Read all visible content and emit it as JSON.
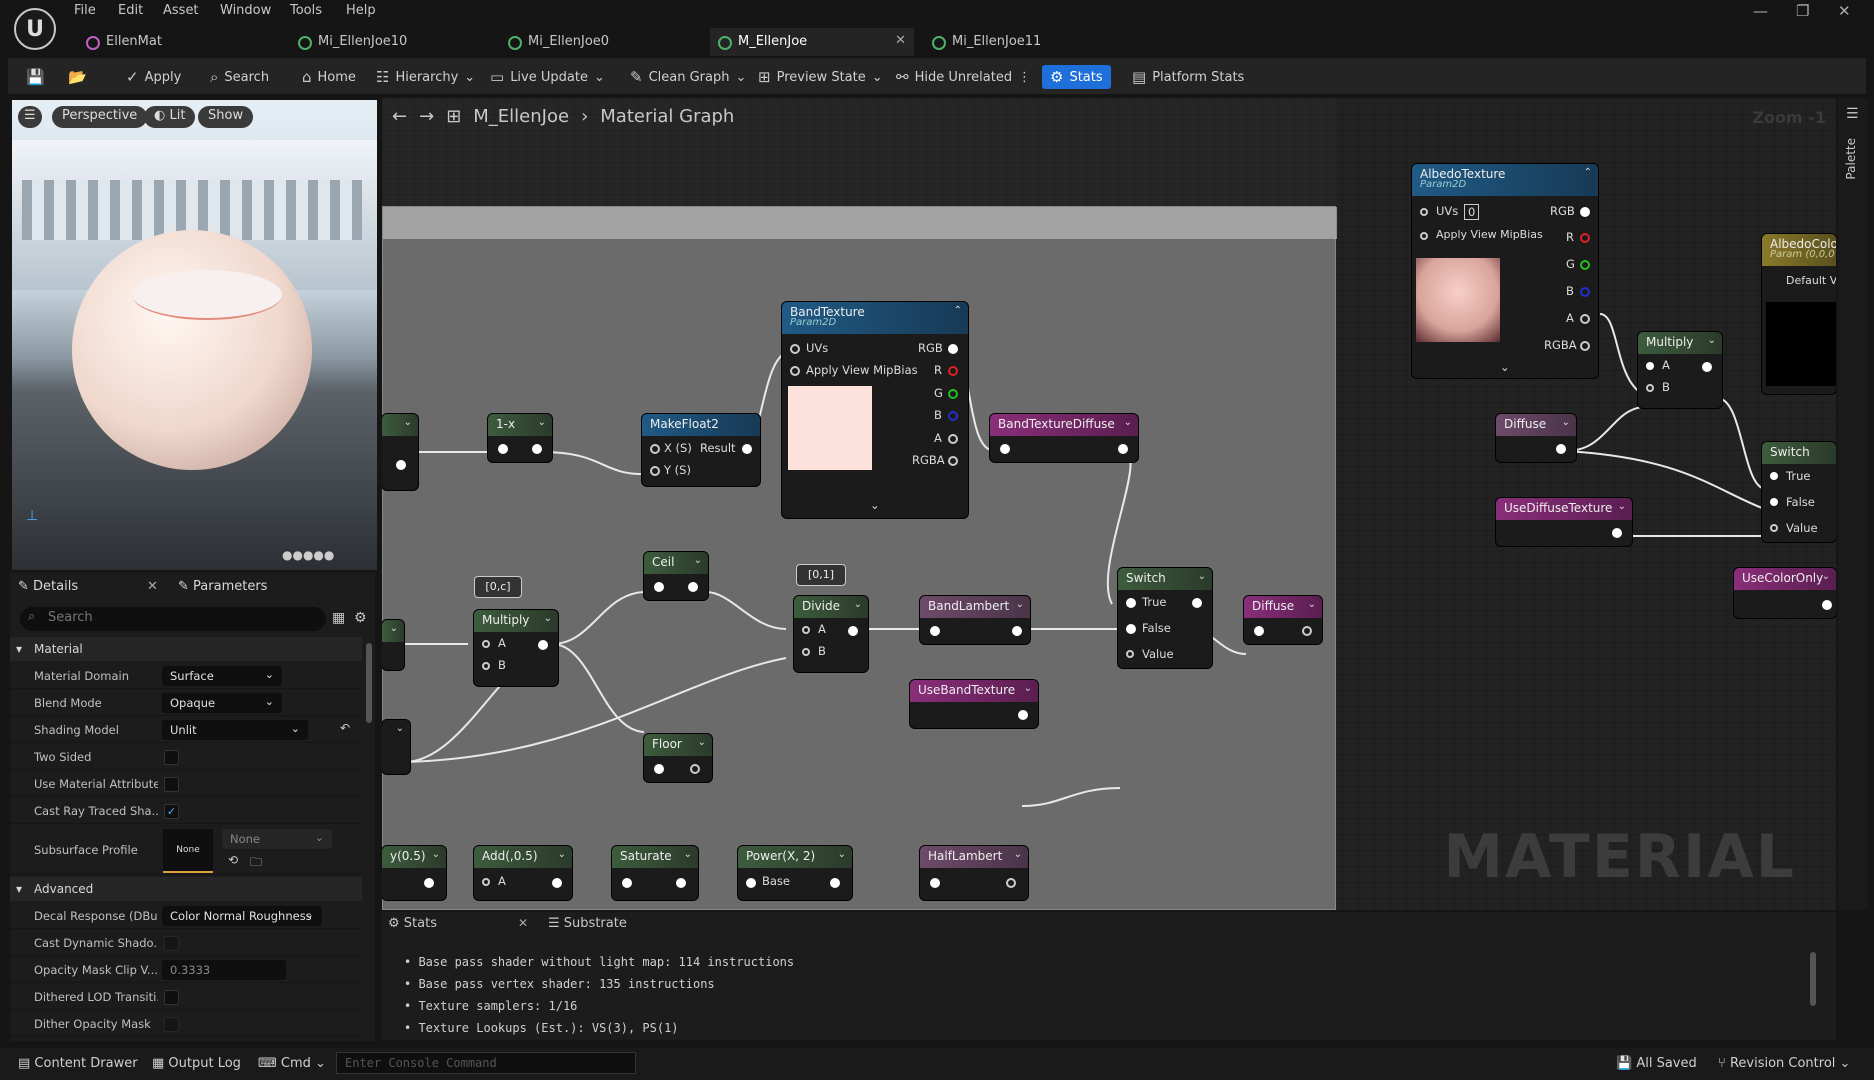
{
  "menu": [
    "File",
    "Edit",
    "Asset",
    "Window",
    "Tools",
    "Help"
  ],
  "tabs": [
    {
      "label": "EllenMat",
      "type": "mat"
    },
    {
      "label": "Mi_EllenJoe10",
      "type": "inst"
    },
    {
      "label": "Mi_EllenJoe0",
      "type": "inst"
    },
    {
      "label": "M_EllenJoe",
      "type": "inst",
      "active": true
    },
    {
      "label": "Mi_EllenJoe11",
      "type": "inst"
    }
  ],
  "toolbar": {
    "apply": "Apply",
    "search": "Search",
    "home": "Home",
    "hierarchy": "Hierarchy",
    "live_update": "Live Update",
    "clean_graph": "Clean Graph",
    "preview_state": "Preview State",
    "hide_unrelated": "Hide Unrelated",
    "stats": "Stats",
    "platform_stats": "Platform Stats"
  },
  "viewport": {
    "perspective": "Perspective",
    "lit": "Lit",
    "show": "Show"
  },
  "details": {
    "tab_details": "Details",
    "tab_parameters": "Parameters",
    "search_placeholder": "Search",
    "section_material": "Material",
    "section_advanced": "Advanced",
    "material_domain_lbl": "Material Domain",
    "material_domain": "Surface",
    "blend_mode_lbl": "Blend Mode",
    "blend_mode": "Opaque",
    "shading_model_lbl": "Shading Model",
    "shading_model": "Unlit",
    "two_sided_lbl": "Two Sided",
    "use_mat_attr_lbl": "Use Material Attributes",
    "cast_ray_lbl": "Cast Ray Traced Sha...",
    "subsurface_lbl": "Subsurface Profile",
    "subsurface_thumb": "None",
    "subsurface_val": "None",
    "decal_lbl": "Decal Response (DBu...",
    "decal_val": "Color Normal Roughness",
    "cast_dyn_lbl": "Cast Dynamic Shado...",
    "opacity_clip_lbl": "Opacity Mask Clip V...",
    "opacity_clip_val": "0.3333",
    "dithered_lod_lbl": "Dithered LOD Transiti...",
    "dither_opacity_lbl": "Dither Opacity Mask"
  },
  "graph": {
    "breadcrumb_root": "M_EllenJoe",
    "breadcrumb_leaf": "Material Graph",
    "zoom": "Zoom -1",
    "watermark": "MATERIAL",
    "palette": "Palette",
    "nodes": {
      "one_minus": "1-x",
      "make_float2": "MakeFloat2",
      "mf2_x": "X (S)",
      "mf2_result": "Result",
      "mf2_y": "Y (S)",
      "band_texture": "BandTexture",
      "param2d": "Param2D",
      "uvs": "UVs",
      "apply_mip": "Apply View MipBias",
      "rgb": "RGB",
      "r": "R",
      "g": "G",
      "b": "B",
      "a": "A",
      "rgba": "RGBA",
      "band_tex_diffuse": "BandTextureDiffuse",
      "ceil": "Ceil",
      "multiply": "Multiply",
      "pin_a": "A",
      "pin_b": "B",
      "clamp_badge": "[0,c]",
      "divide_badge": "[0,1]",
      "divide": "Divide",
      "band_lambert": "BandLambert",
      "switch": "Switch",
      "sw_true": "True",
      "sw_false": "False",
      "sw_value": "Value",
      "diffuse_out": "Diffuse",
      "use_band_texture": "UseBandTexture",
      "floor": "Floor",
      "y05": "y(0.5)",
      "add05": "Add(,0.5)",
      "saturate": "Saturate",
      "power": "Power(X, 2)",
      "power_base": "Base",
      "half_lambert": "HalfLambert",
      "albedo_texture": "AlbedoTexture",
      "uvs_idx": "0",
      "albedo_color": "AlbedoColo",
      "albedo_color_sub": "Param (0,0,0",
      "default_val": "Default V",
      "multiply2": "Multiply",
      "diffuse_param": "Diffuse",
      "use_diffuse_tex": "UseDiffuseTexture",
      "switch2": "Switch",
      "use_color_only": "UseColorOnly"
    }
  },
  "stats_panel": {
    "tab_stats": "Stats",
    "tab_substrate": "Substrate",
    "lines": [
      "• Base pass shader without light map: 114 instructions",
      "• Base pass vertex shader: 135 instructions",
      "• Texture samplers: 1/16",
      "• Texture Lookups (Est.): VS(3), PS(1)"
    ]
  },
  "statusbar": {
    "content_drawer": "Content Drawer",
    "output_log": "Output Log",
    "cmd": "Cmd",
    "console_placeholder": "Enter Console Command",
    "all_saved": "All Saved",
    "revision_control": "Revision Control"
  }
}
